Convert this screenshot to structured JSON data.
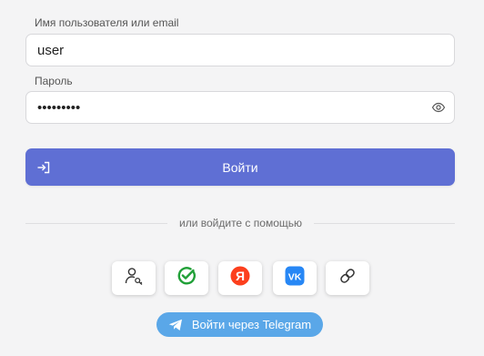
{
  "form": {
    "username_label": "Имя пользователя или email",
    "username_value": "user",
    "password_label": "Пароль",
    "password_value": "secretpw1",
    "login_button": "Войти",
    "divider_text": "или войдите с помощью",
    "telegram_button": "Войти через Telegram"
  },
  "social_icons": [
    "user-key-icon",
    "sber-icon",
    "yandex-icon",
    "vk-icon",
    "link-icon"
  ],
  "colors": {
    "accent": "#5f6fd4",
    "telegram": "#5aa7e8",
    "sber_green": "#21a038",
    "yandex_red": "#fc3f1d",
    "vk_blue": "#2787f5"
  }
}
